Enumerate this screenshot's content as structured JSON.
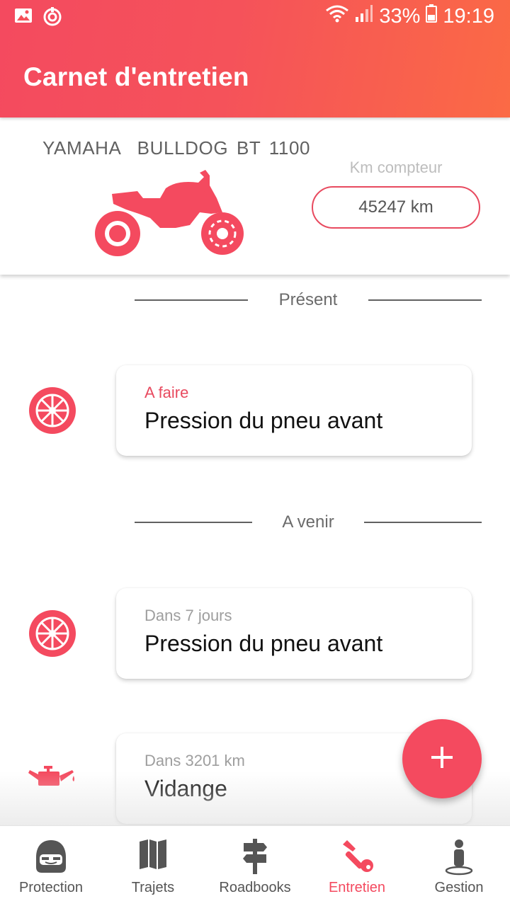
{
  "status_bar": {
    "battery": "33%",
    "time": "19:19"
  },
  "header": {
    "title": "Carnet d'entretien"
  },
  "vehicle": {
    "name": "YAMAHA  BULLDOG BT 1100",
    "odometer_label": "Km compteur",
    "odometer_value": "45247 km"
  },
  "sections": {
    "present": "Présent",
    "upcoming": "A venir"
  },
  "tasks": [
    {
      "status": "A faire",
      "title": "Pression du pneu avant",
      "icon": "tire-icon"
    },
    {
      "status": "Dans 7 jours",
      "title": "Pression du pneu avant",
      "icon": "tire-icon"
    },
    {
      "status": "Dans 3201 km",
      "title": "Vidange",
      "icon": "oil-can-icon"
    }
  ],
  "fab": {
    "icon": "plus-icon"
  },
  "nav": [
    {
      "label": "Protection",
      "icon": "helmet-icon"
    },
    {
      "label": "Trajets",
      "icon": "map-icon"
    },
    {
      "label": "Roadbooks",
      "icon": "signpost-icon"
    },
    {
      "label": "Entretien",
      "icon": "wrench-icon"
    },
    {
      "label": "Gestion",
      "icon": "person-icon"
    }
  ],
  "colors": {
    "accent": "#f44a5f",
    "accent_orange": "#fb6a45",
    "text_dark": "#111111",
    "text_muted": "#9e9e9e"
  }
}
